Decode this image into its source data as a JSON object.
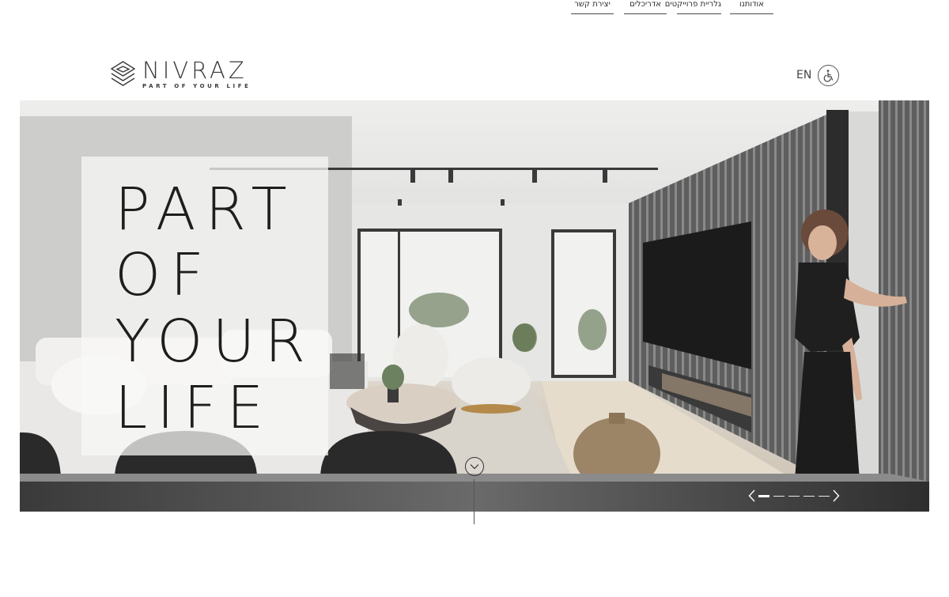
{
  "header": {
    "logo_name": "NIVRAZ",
    "logo_tagline": "PART OF YOUR LIFE",
    "nav": [
      {
        "label": "יצירת קשר"
      },
      {
        "label": "אדריכלים"
      },
      {
        "label": "גלריית פרוייקטים"
      },
      {
        "label": "אודותנו"
      }
    ],
    "lang_label": "EN",
    "accessibility_icon": "wheelchair-icon"
  },
  "hero": {
    "headline_lines": [
      "PART",
      "OF",
      "YOUR",
      "LIFE"
    ],
    "scroll_icon": "chevron-down-icon",
    "slider": {
      "prev_icon": "chevron-left-icon",
      "next_icon": "chevron-right-icon",
      "slide_count": 5,
      "active_slide": 1
    }
  },
  "colors": {
    "text": "#2b2b2b",
    "background": "#ffffff"
  }
}
